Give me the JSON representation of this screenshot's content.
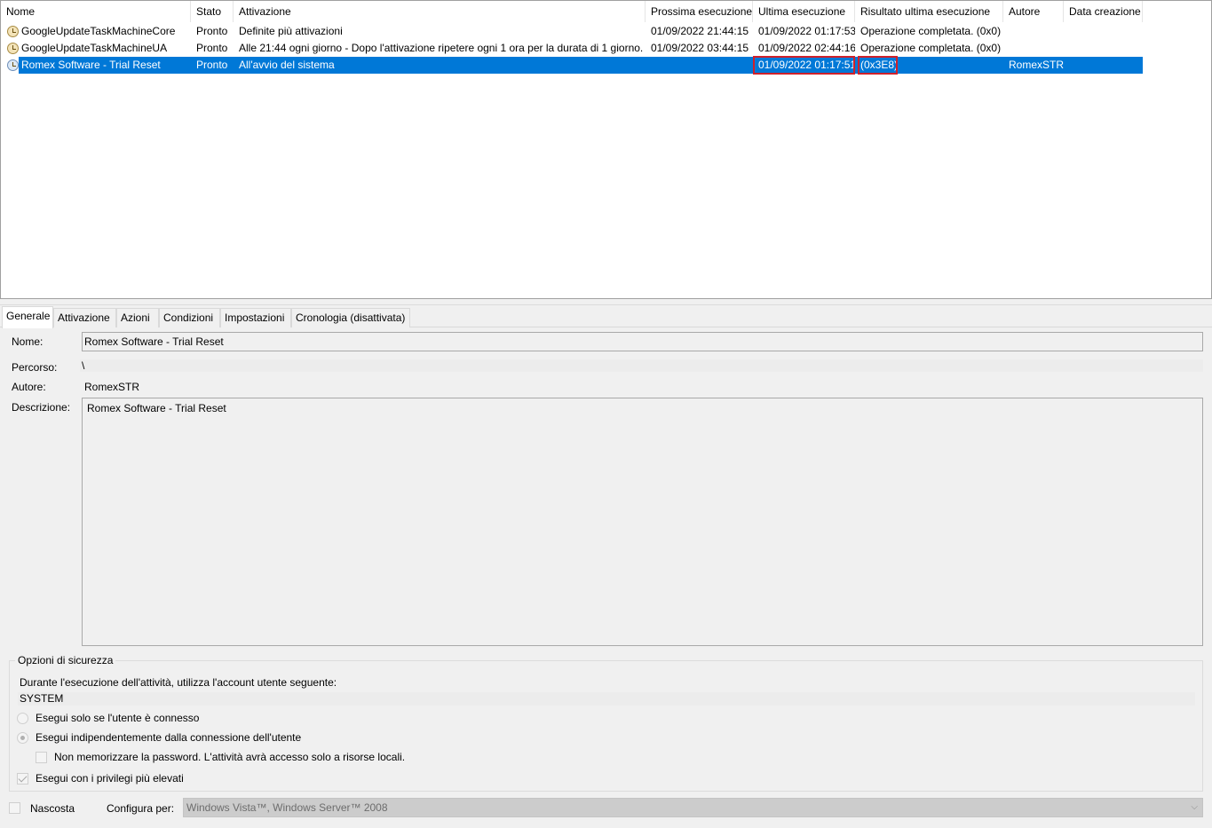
{
  "columns": [
    "Nome",
    "Stato",
    "Attivazione",
    "Prossima esecuzione",
    "Ultima esecuzione",
    "Risultato ultima esecuzione",
    "Autore",
    "Data creazione"
  ],
  "tasks": [
    {
      "name": "GoogleUpdateTaskMachineCore",
      "status": "Pronto",
      "trigger": "Definite più attivazioni",
      "next_run": "01/09/2022 21:44:15",
      "last_run": "01/09/2022 01:17:53",
      "last_result": "Operazione completata. (0x0)",
      "author": "",
      "created": ""
    },
    {
      "name": "GoogleUpdateTaskMachineUA",
      "status": "Pronto",
      "trigger": "Alle 21:44 ogni giorno - Dopo l'attivazione ripetere ogni 1 ora per la durata di 1 giorno.",
      "next_run": "01/09/2022 03:44:15",
      "last_run": "01/09/2022 02:44:16",
      "last_result": "Operazione completata. (0x0)",
      "author": "",
      "created": ""
    },
    {
      "name": "Romex Software - Trial Reset",
      "status": "Pronto",
      "trigger": "All'avvio del sistema",
      "next_run": "",
      "last_run": "01/09/2022 01:17:51",
      "last_result": "(0x3E8)",
      "author": "RomexSTR",
      "created": "",
      "selected": true
    }
  ],
  "highlight_color": "#d0212b",
  "selection_color": "#0078d7",
  "tabs": [
    "Generale",
    "Attivazione",
    "Azioni",
    "Condizioni",
    "Impostazioni",
    "Cronologia (disattivata)"
  ],
  "general": {
    "name_label": "Nome:",
    "name_value": "Romex Software - Trial Reset",
    "path_label": "Percorso:",
    "path_value": "\\",
    "author_label": "Autore:",
    "author_value": "RomexSTR",
    "description_label": "Descrizione:",
    "description_value": "Romex Software - Trial Reset"
  },
  "security": {
    "title": "Opzioni di sicurezza",
    "account_prompt": "Durante l'esecuzione dell'attività, utilizza l'account utente seguente:",
    "account": "SYSTEM",
    "radio_logged_on": "Esegui solo se l'utente è connesso",
    "radio_whether_logged": "Esegui indipendentemente dalla connessione dell'utente",
    "no_store_password": "Non memorizzare la password. L'attività avrà accesso solo a risorse locali.",
    "highest_privileges": "Esegui con i privilegi più elevati"
  },
  "hidden_label": "Nascosta",
  "configure_label": "Configura per:",
  "configure_value": "Windows Vista™, Windows Server™ 2008"
}
